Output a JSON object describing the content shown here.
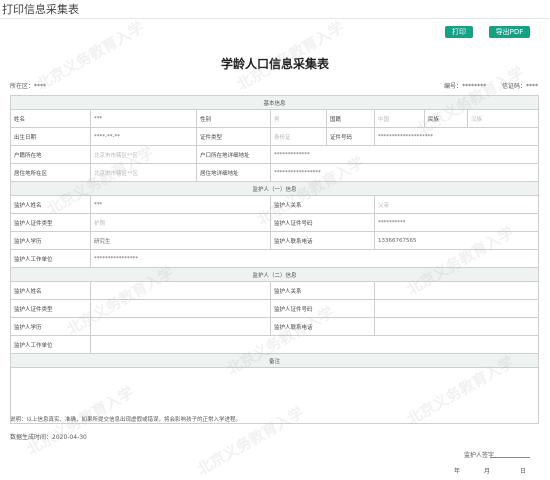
{
  "page": {
    "title": "打印信息采集表"
  },
  "toolbar": {
    "print_label": "打印",
    "export_pdf_label": "导出PDF"
  },
  "form": {
    "title": "学龄人口信息采集表",
    "district_label": "所在区：",
    "district_value": "****",
    "number_label": "编号：",
    "number_value": "********",
    "cert_label": "信证码：",
    "cert_value": "****"
  },
  "basic": {
    "section": "基本信息",
    "name_label": "姓名",
    "name_value": "***",
    "gender_label": "性别",
    "gender_value": "男",
    "nation_label": "国籍",
    "nation_value": "中国",
    "ethnic_label": "民族",
    "ethnic_value": "汉族",
    "birth_label": "出生日期",
    "birth_value": "****-**-**",
    "idtype_label": "证件类型",
    "idtype_value": "身份证",
    "idno_label": "证件号码",
    "idno_value": "********************",
    "hukou_label": "户籍所在地",
    "hukou_value": "北京市市辖区**区",
    "hukou_addr_label": "户口所在地详细地址",
    "hukou_addr_value": "*************",
    "live_label": "居住地所在区",
    "live_value": "北京市市辖区**区",
    "live_addr_label": "居住地详细地址",
    "live_addr_value": "*****************"
  },
  "guardian1": {
    "section": "监护人（一）信息",
    "name_label": "监护人姓名",
    "name_value": "***",
    "rel_label": "监护人关系",
    "rel_value": "父亲",
    "idtype_label": "监护人证件类型",
    "idtype_value": "护照",
    "idno_label": "监护人证件号码",
    "idno_value": "**********",
    "edu_label": "监护人学历",
    "edu_value": "研究生",
    "phone_label": "监护人联系电话",
    "phone_value": "13366767565",
    "work_label": "监护人工作单位",
    "work_value": "****************"
  },
  "guardian2": {
    "section": "监护人（二）信息",
    "name_label": "监护人姓名",
    "rel_label": "监护人关系",
    "idtype_label": "监护人证件类型",
    "idno_label": "监护人证件号码",
    "edu_label": "监护人学历",
    "phone_label": "监护人联系电话",
    "work_label": "监护人工作单位"
  },
  "remarks": {
    "section": "备注"
  },
  "footer": {
    "note": "说明：以上信息真实、准确，如果所提交信息出现虚假或错误，将会影响孩子的正常入学进程。",
    "generated": "数据生成时间：2020-04-30",
    "signature_label": "监护人签字",
    "date_year": "年",
    "date_month": "月",
    "date_day": "日"
  },
  "watermark": {
    "text": "北京义务教育入学"
  }
}
